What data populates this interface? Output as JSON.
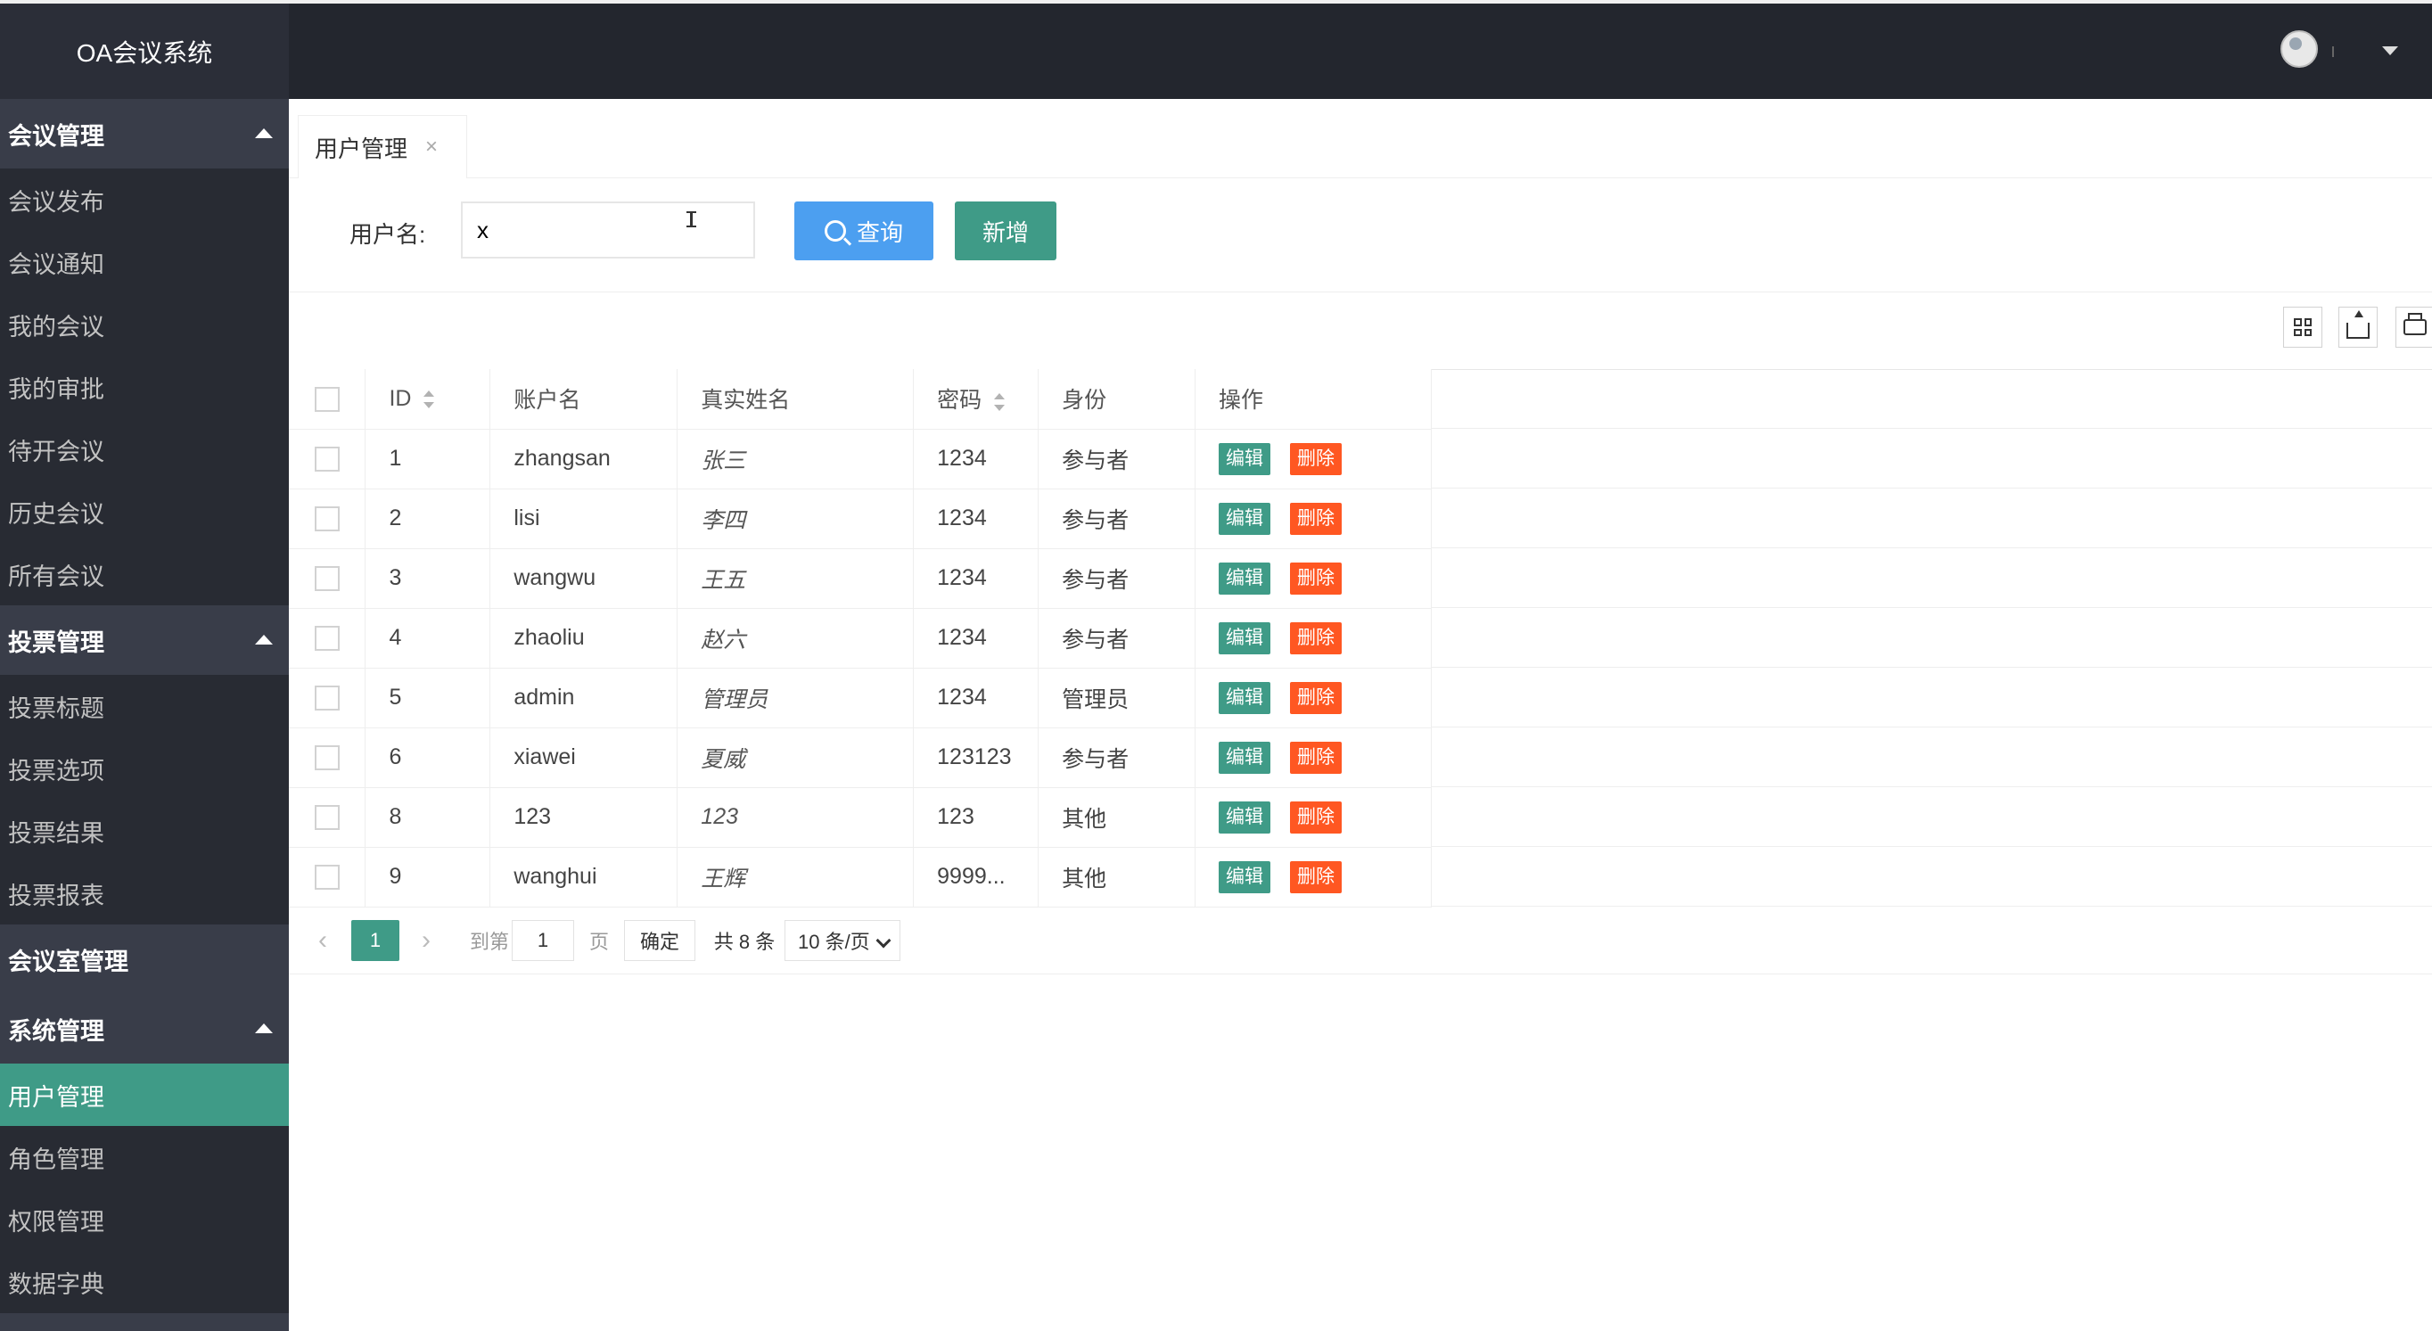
{
  "app": {
    "title": "OA会议系统"
  },
  "sidebar": {
    "groups": [
      {
        "title": "会议管理",
        "items": [
          "会议发布",
          "会议通知",
          "我的会议",
          "我的审批",
          "待开会议",
          "历史会议",
          "所有会议"
        ]
      },
      {
        "title": "投票管理",
        "items": [
          "投票标题",
          "投票选项",
          "投票结果",
          "投票报表"
        ]
      },
      {
        "title": "会议室管理",
        "items": []
      },
      {
        "title": "系统管理",
        "items": [
          "用户管理",
          "角色管理",
          "权限管理",
          "数据字典"
        ]
      }
    ],
    "active_item": "用户管理"
  },
  "tabs": [
    {
      "label": "用户管理",
      "close": "×"
    }
  ],
  "search": {
    "label": "用户名:",
    "value": "x",
    "query_label": "查询",
    "add_label": "新增"
  },
  "table": {
    "headers": {
      "id": "ID",
      "account": "账户名",
      "realname": "真实姓名",
      "password": "密码",
      "role": "身份",
      "ops": "操作"
    },
    "edit_label": "编辑",
    "delete_label": "删除",
    "rows": [
      {
        "id": "1",
        "account": "zhangsan",
        "realname": "张三",
        "password": "1234",
        "role": "参与者"
      },
      {
        "id": "2",
        "account": "lisi",
        "realname": "李四",
        "password": "1234",
        "role": "参与者"
      },
      {
        "id": "3",
        "account": "wangwu",
        "realname": "王五",
        "password": "1234",
        "role": "参与者"
      },
      {
        "id": "4",
        "account": "zhaoliu",
        "realname": "赵六",
        "password": "1234",
        "role": "参与者"
      },
      {
        "id": "5",
        "account": "admin",
        "realname": "管理员",
        "password": "1234",
        "role": "管理员"
      },
      {
        "id": "6",
        "account": "xiawei",
        "realname": "夏威",
        "password": "123123",
        "role": "参与者"
      },
      {
        "id": "8",
        "account": "123",
        "realname": "123",
        "password": "123",
        "role": "其他"
      },
      {
        "id": "9",
        "account": "wanghui",
        "realname": "王辉",
        "password": "9999...",
        "role": "其他"
      }
    ]
  },
  "pager": {
    "prev": "‹",
    "current": "1",
    "next": "›",
    "goto_label": "到第",
    "goto_value": "1",
    "page_label": "页",
    "confirm_label": "确定",
    "total_label": "共 8 条",
    "size_label": "10 条/页"
  },
  "colors": {
    "sidebar_bg": "#2b2e38",
    "topbar_bg": "#23262e",
    "accent_green": "#3f9b87",
    "query_blue": "#4c9ff0",
    "delete_orange": "#ff5722"
  },
  "icons": {
    "toolbar": [
      "columns-icon",
      "export-icon",
      "print-icon"
    ]
  }
}
